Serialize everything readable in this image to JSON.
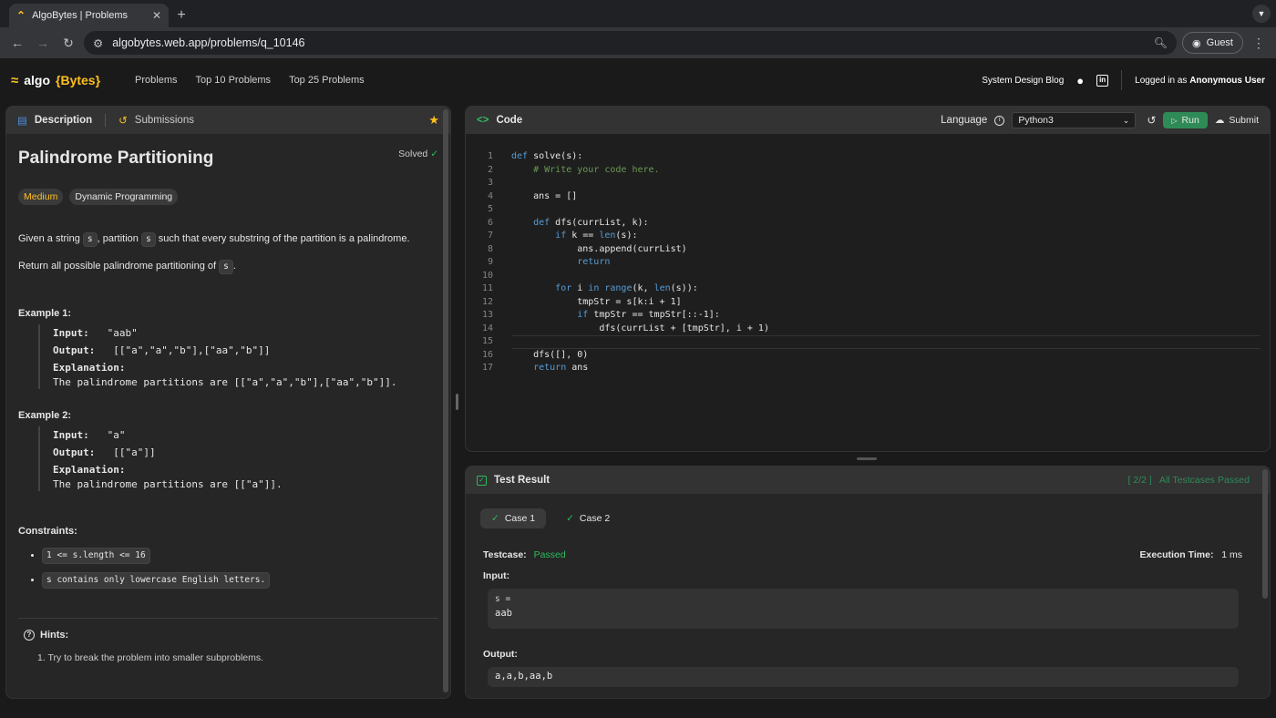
{
  "browser": {
    "tab_title": "AlgoBytes | Problems",
    "url": "algobytes.web.app/problems/q_10146",
    "profile": "Guest"
  },
  "header": {
    "logo_text": "algo",
    "logo_brace": "{Bytes}",
    "nav": [
      "Problems",
      "Top 10 Problems",
      "Top 25 Problems"
    ],
    "blog": "System Design Blog",
    "logged_prefix": "Logged in as ",
    "user": "Anonymous User"
  },
  "description": {
    "tab_description": "Description",
    "tab_submissions": "Submissions",
    "title": "Palindrome Partitioning",
    "status": "Solved",
    "difficulty": "Medium",
    "topic": "Dynamic Programming",
    "p1_a": "Given a string ",
    "p1_code": "s",
    "p1_b": ", partition ",
    "p1_code2": "s",
    "p1_c": " such that every substring of the partition is a palindrome.",
    "p2_a": "Return all possible palindrome partitioning of ",
    "p2_code": "s",
    "p2_b": ".",
    "examples": [
      {
        "title": "Example 1:",
        "input_label": "Input:",
        "input": "\"aab\"",
        "output_label": "Output:",
        "output": "[[\"a\",\"a\",\"b\"],[\"aa\",\"b\"]]",
        "expl_label": "Explanation:",
        "expl": "The palindrome partitions are [[\"a\",\"a\",\"b\"],[\"aa\",\"b\"]]."
      },
      {
        "title": "Example 2:",
        "input_label": "Input:",
        "input": "\"a\"",
        "output_label": "Output:",
        "output": "[[\"a\"]]",
        "expl_label": "Explanation:",
        "expl": "The palindrome partitions are [[\"a\"]]."
      }
    ],
    "constraints_title": "Constraints:",
    "constraints": [
      "1 <= s.length <= 16",
      "s contains only lowercase English letters."
    ],
    "hints_title": "Hints:",
    "hint1": "1. Try to break the problem into smaller subproblems."
  },
  "code": {
    "title": "Code",
    "language_label": "Language",
    "language": "Python3",
    "run": "Run",
    "submit": "Submit",
    "lines": [
      "def solve(s):",
      "    # Write your code here.",
      "",
      "    ans = []",
      "",
      "    def dfs(currList, k):",
      "        if k == len(s):",
      "            ans.append(currList)",
      "            return",
      "",
      "        for i in range(k, len(s)):",
      "            tmpStr = s[k:i + 1]",
      "            if tmpStr == tmpStr[::-1]:",
      "                dfs(currList + [tmpStr], i + 1)",
      "",
      "    dfs([], 0)",
      "    return ans"
    ]
  },
  "result": {
    "title": "Test Result",
    "summary_count": "[ 2/2 ]",
    "summary_text": "All Testcases Passed",
    "case1": "Case 1",
    "case2": "Case 2",
    "testcase_label": "Testcase:",
    "testcase_status": "Passed",
    "exec_label": "Execution Time:",
    "exec_value": "1 ms",
    "input_label": "Input:",
    "input_var": "s =",
    "input_value": "aab",
    "output_label": "Output:",
    "output_value": "a,a,b,aa,b"
  },
  "colors": {
    "accent": "#ffc01e",
    "success": "#2cbb5d",
    "run_button": "#2e8b57"
  }
}
